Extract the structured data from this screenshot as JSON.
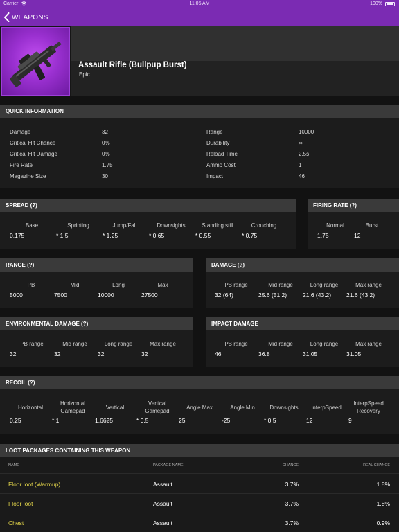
{
  "status_bar": {
    "carrier": "Carrier",
    "time": "11:05 AM",
    "battery": "100%"
  },
  "nav": {
    "back_label": "WEAPONS"
  },
  "weapon": {
    "name": "Assault Rifle (Bullpup Burst)",
    "rarity": "Epic"
  },
  "quick_info": {
    "header": "QUICK INFORMATION",
    "left": [
      {
        "label": "Damage",
        "value": "32"
      },
      {
        "label": "Critical Hit Chance",
        "value": "0%"
      },
      {
        "label": "Critical Hit Damage",
        "value": "0%"
      },
      {
        "label": "Fire Rate",
        "value": "1.75"
      },
      {
        "label": "Magazine Size",
        "value": "30"
      }
    ],
    "right": [
      {
        "label": "Range",
        "value": "10000"
      },
      {
        "label": "Durability",
        "value": "∞"
      },
      {
        "label": "Reload Time",
        "value": "2.5s"
      },
      {
        "label": "Ammo Cost",
        "value": "1"
      },
      {
        "label": "Impact",
        "value": "46"
      }
    ]
  },
  "spread": {
    "header": "SPREAD (?)",
    "cols": [
      {
        "label": "Base",
        "value": "0.175"
      },
      {
        "label": "Sprinting",
        "value": "* 1.5"
      },
      {
        "label": "Jump/Fall",
        "value": "* 1.25"
      },
      {
        "label": "Downsights",
        "value": "* 0.65"
      },
      {
        "label": "Standing still",
        "value": "* 0.55"
      },
      {
        "label": "Crouching",
        "value": "* 0.75"
      }
    ]
  },
  "firing_rate": {
    "header": "FIRING RATE (?)",
    "cols": [
      {
        "label": "Normal",
        "value": "1.75"
      },
      {
        "label": "Burst",
        "value": "12"
      }
    ]
  },
  "range": {
    "header": "RANGE (?)",
    "cols": [
      {
        "label": "PB",
        "value": "5000"
      },
      {
        "label": "Mid",
        "value": "7500"
      },
      {
        "label": "Long",
        "value": "10000"
      },
      {
        "label": "Max",
        "value": "27500"
      }
    ]
  },
  "damage": {
    "header": "DAMAGE (?)",
    "cols": [
      {
        "label": "PB range",
        "value": "32 (64)"
      },
      {
        "label": "Mid range",
        "value": "25.6 (51.2)"
      },
      {
        "label": "Long range",
        "value": "21.6 (43.2)"
      },
      {
        "label": "Max range",
        "value": "21.6 (43.2)"
      }
    ]
  },
  "env_damage": {
    "header": "ENVIRONMENTAL DAMAGE (?)",
    "cols": [
      {
        "label": "PB range",
        "value": "32"
      },
      {
        "label": "Mid range",
        "value": "32"
      },
      {
        "label": "Long range",
        "value": "32"
      },
      {
        "label": "Max range",
        "value": "32"
      }
    ]
  },
  "impact_damage": {
    "header": "IMPACT DAMAGE",
    "cols": [
      {
        "label": "PB range",
        "value": "46"
      },
      {
        "label": "Mid range",
        "value": "36.8"
      },
      {
        "label": "Long range",
        "value": "31.05"
      },
      {
        "label": "Max range",
        "value": "31.05"
      }
    ]
  },
  "recoil": {
    "header": "RECOIL (?)",
    "cols": [
      {
        "label": "Horizontal",
        "value": "0.25"
      },
      {
        "label": "Horizontal Gamepad",
        "value": "* 1"
      },
      {
        "label": "Vertical",
        "value": "1.6625"
      },
      {
        "label": "Vertical Gamepad",
        "value": "* 0.5"
      },
      {
        "label": "Angle Max",
        "value": "25"
      },
      {
        "label": "Angle Min",
        "value": "-25"
      },
      {
        "label": "Downsights",
        "value": "* 0.5"
      },
      {
        "label": "InterpSpeed",
        "value": "12"
      },
      {
        "label": "InterpSpeed Recovery",
        "value": "9"
      }
    ]
  },
  "loot": {
    "header": "LOOT PACKAGES CONTAINING THIS WEAPON",
    "columns": {
      "name": "NAME",
      "package": "PACKAGE NAME",
      "chance": "CHANCE",
      "real_chance": "REAL CHANCE"
    },
    "rows": [
      {
        "name": "Floor loot (Warmup)",
        "package": "Assault",
        "chance": "3.7%",
        "real_chance": "1.8%"
      },
      {
        "name": "Floor loot",
        "package": "Assault",
        "chance": "3.7%",
        "real_chance": "1.8%"
      },
      {
        "name": "Chest",
        "package": "Assault",
        "chance": "3.7%",
        "real_chance": "0.9%"
      }
    ]
  },
  "colors": {
    "accent": "#7b2bb3",
    "epic": "#9a30d0",
    "loot_link": "#e2d44a"
  }
}
